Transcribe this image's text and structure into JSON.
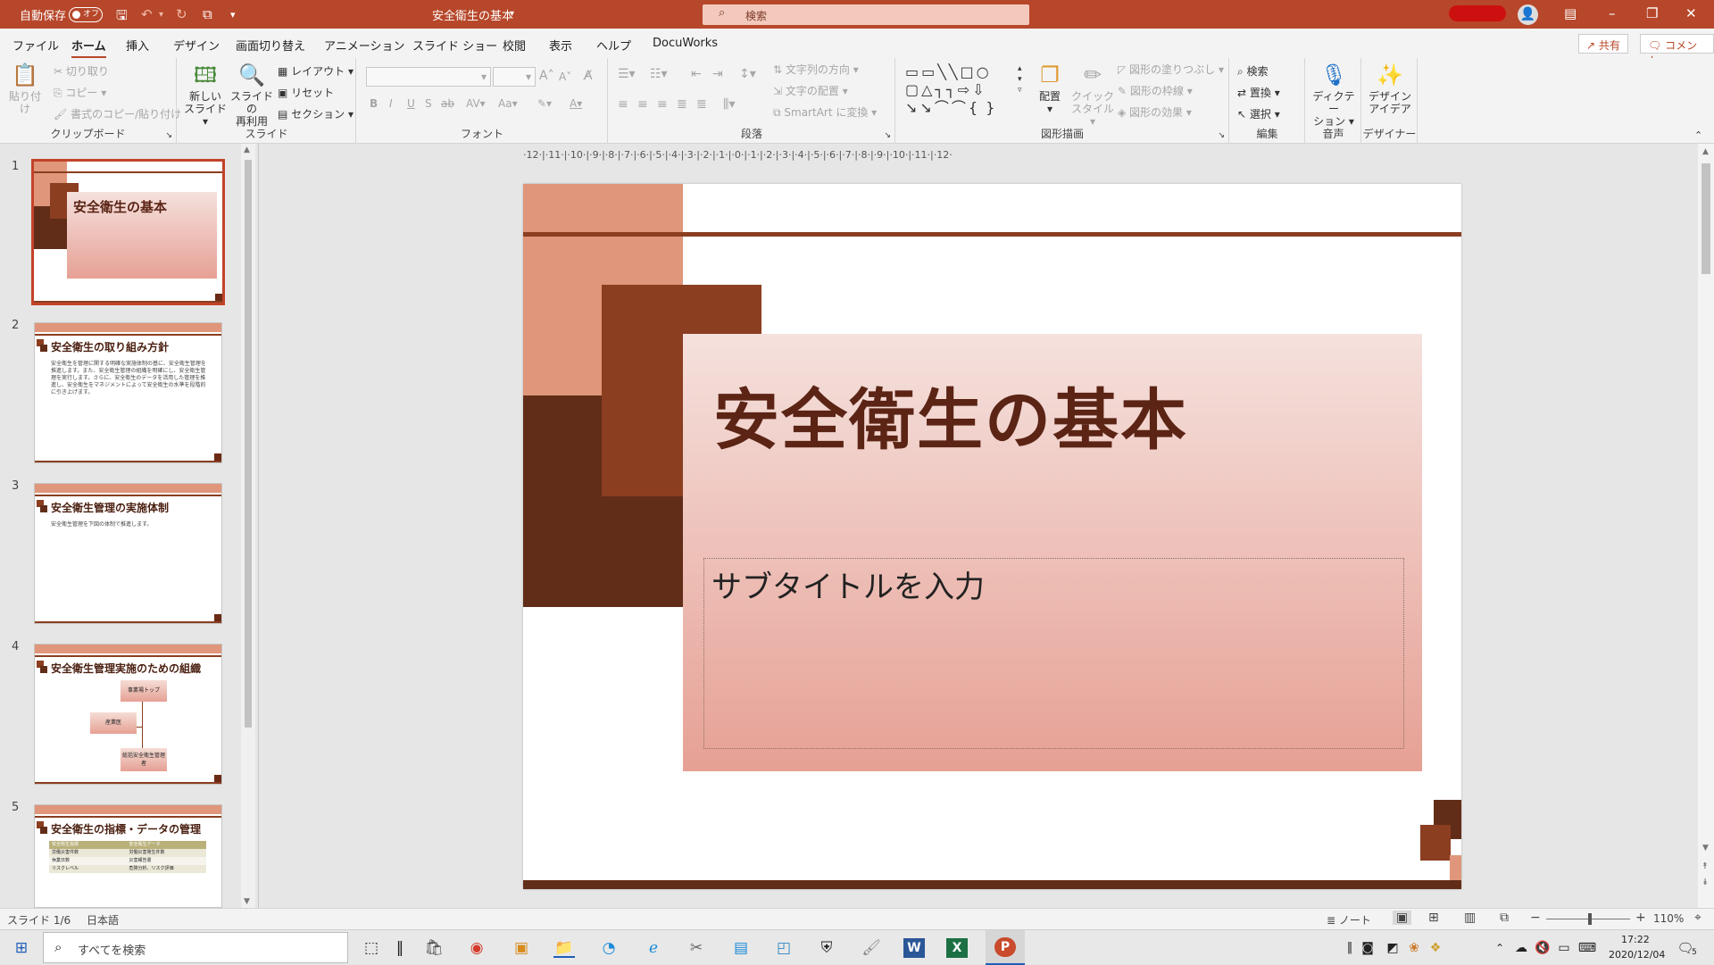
{
  "titlebar": {
    "autosave_label": "自動保存",
    "autosave_state": "オフ",
    "doc_title": "安全衛生の基本",
    "search_placeholder": "検索"
  },
  "tabs": [
    "ファイル",
    "ホーム",
    "挿入",
    "デザイン",
    "画面切り替え",
    "アニメーション",
    "スライド ショー",
    "校閲",
    "表示",
    "ヘルプ",
    "DocuWorks"
  ],
  "share_label": "共有",
  "comment_label": "コメント",
  "ribbon": {
    "clipboard": {
      "label": "クリップボード",
      "paste": "貼り付け",
      "cut": "切り取り",
      "copy": "コピー",
      "format_painter": "書式のコピー/貼り付け"
    },
    "slides": {
      "label": "スライド",
      "new_slide_1": "新しい",
      "new_slide_2": "スライド",
      "reuse_1": "スライドの",
      "reuse_2": "再利用",
      "layout": "レイアウト",
      "reset": "リセット",
      "section": "セクション"
    },
    "font": {
      "label": "フォント"
    },
    "paragraph": {
      "label": "段落",
      "text_direction": "文字列の方向",
      "align_text": "文字の配置",
      "smartart": "SmartArt に変換"
    },
    "drawing": {
      "label": "図形描画",
      "arrange": "配置",
      "quick_1": "クイック",
      "quick_2": "スタイル",
      "fill": "図形の塗りつぶし",
      "outline": "図形の枠線",
      "effects": "図形の効果"
    },
    "editing": {
      "label": "編集",
      "find": "検索",
      "replace": "置換",
      "select": "選択"
    },
    "voice": {
      "label": "音声",
      "dictate_1": "ディクテー",
      "dictate_2": "ション"
    },
    "designer": {
      "label": "デザイナー",
      "ideas_1": "デザイン",
      "ideas_2": "アイデア"
    }
  },
  "thumbnails": [
    {
      "num": "1",
      "title": "安全衛生の基本"
    },
    {
      "num": "2",
      "title": "安全衛生の取り組み方針",
      "body": "安全衛生を管理に関する明確な実施体制の基に、安全衛生管理を推進します。また、安全衛生管理の組織を明確にし、安全衛生管理を実行します。さらに、安全衛生のデータを活用した管理を推進し、安全衛生をマネジメントによって安全衛生の水準を段階的に引き上げます。"
    },
    {
      "num": "3",
      "title": "安全衛生管理の実施体制",
      "body": "安全衛生管理を下図の体制で推進します。"
    },
    {
      "num": "4",
      "title": "安全衛生管理実施のための組織",
      "org": [
        "事業場トップ",
        "産業医",
        "総括安全衛生管理者"
      ]
    },
    {
      "num": "5",
      "title": "安全衛生の指標・データの管理",
      "table": [
        [
          "安全衛生指標",
          "安全衛生データ"
        ],
        [
          "労働災害件数",
          "労働災害発生件数"
        ],
        [
          "休業日数",
          "災害報告書"
        ],
        [
          "リスクレベル",
          "危険分析、リスク評価"
        ]
      ]
    }
  ],
  "slide": {
    "title": "安全衛生の基本",
    "subtitle": "サブタイトルを入力"
  },
  "status": {
    "slide_counter": "スライド 1/6",
    "language": "日本語",
    "notes": "ノート",
    "zoom": "110%"
  },
  "taskbar": {
    "search_placeholder": "すべてを検索",
    "time": "17:22",
    "date": "2020/12/04",
    "notification_count": "5"
  },
  "colors": {
    "accent": "#b7472a",
    "dark_brown": "#622d18",
    "mid_brown": "#8b3e20",
    "salmon": "#e0967a",
    "pink_start": "#f5e1dd",
    "pink_end": "#e6a094",
    "title_text": "#5b2415"
  }
}
